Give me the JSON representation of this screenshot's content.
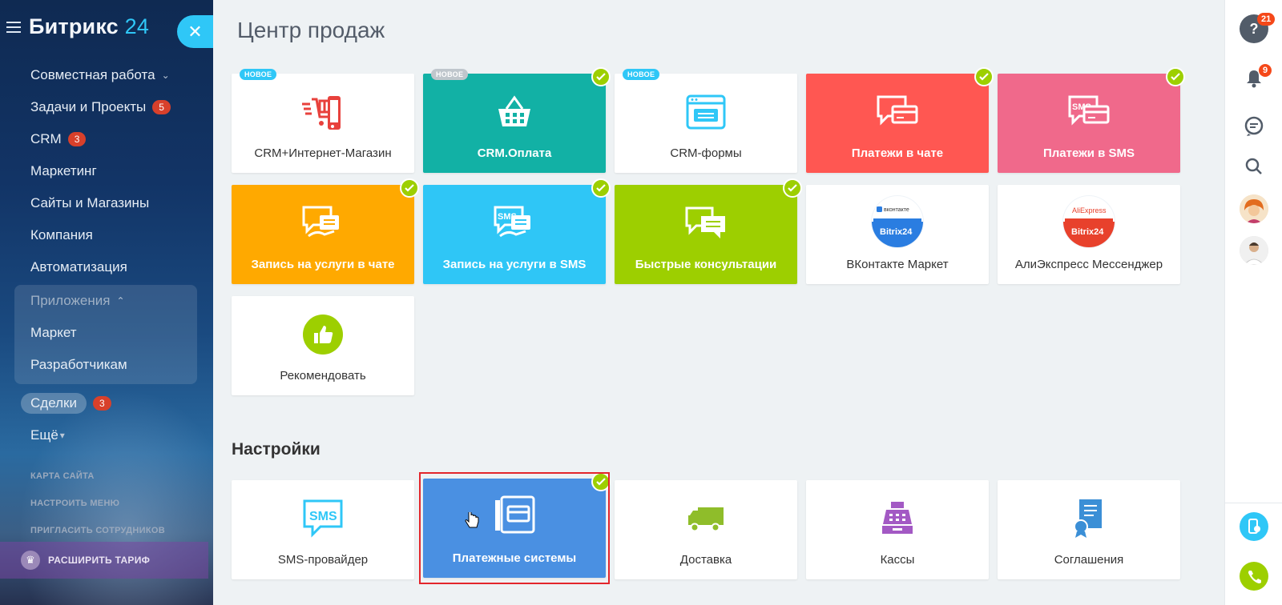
{
  "app": {
    "logo_main": "Битрикс",
    "logo_num": "24",
    "close_symbol": "✕"
  },
  "sidebar": {
    "items": [
      {
        "label": "Совместная работа",
        "chevron": "⌄"
      },
      {
        "label": "Задачи и Проекты",
        "badge": "5"
      },
      {
        "label": "CRM",
        "badge": "3"
      },
      {
        "label": "Маркетинг"
      },
      {
        "label": "Сайты и Магазины"
      },
      {
        "label": "Компания"
      },
      {
        "label": "Автоматизация"
      }
    ],
    "apps_group": {
      "label": "Приложения",
      "chevron": "⌃",
      "items": [
        {
          "label": "Маркет"
        },
        {
          "label": "Разработчикам"
        }
      ]
    },
    "deals": {
      "label": "Сделки",
      "badge": "3"
    },
    "more": {
      "label": "Ещё",
      "chevron": "▾"
    },
    "small_links": [
      "КАРТА САЙТА",
      "НАСТРОИТЬ МЕНЮ",
      "ПРИГЛАСИТЬ СОТРУДНИКОВ"
    ],
    "upgrade_label": "РАСШИРИТЬ ТАРИФ"
  },
  "main": {
    "title": "Центр продаж",
    "settings_title": "Настройки",
    "new_tag": "НОВОЕ",
    "tiles": [
      {
        "label": "CRM+Интернет-Магазин",
        "icon": "cart-icon",
        "tag": "new",
        "bg": "#ffffff"
      },
      {
        "label": "CRM.Оплата",
        "icon": "basket-icon",
        "tag": "new-grey",
        "checked": true,
        "bg": "#12b1a5"
      },
      {
        "label": "CRM-формы",
        "icon": "form-window-icon",
        "tag": "new",
        "bg": "#ffffff"
      },
      {
        "label": "Платежи в чате",
        "icon": "chat-card-icon",
        "checked": true,
        "bg": "#ff5752"
      },
      {
        "label": "Платежи в SMS",
        "icon": "sms-card-icon",
        "checked": true,
        "bg": "#f0698b"
      },
      {
        "label": "Запись на услуги в чате",
        "icon": "chat-booking-icon",
        "checked": true,
        "bg": "#ffa900"
      },
      {
        "label": "Запись на услуги в SMS",
        "icon": "sms-booking-icon",
        "checked": true,
        "bg": "#2fc6f6"
      },
      {
        "label": "Быстрые консультации",
        "icon": "chat-bubbles-icon",
        "checked": true,
        "bg": "#9dcf00"
      },
      {
        "label": "ВКонтакте Маркет",
        "icon": "vk-bitrix-icon",
        "bg": "#ffffff",
        "icon_text_top": "вконтакте",
        "icon_text_bottom": "Bitrix24"
      },
      {
        "label": "АлиЭкспресс Мессенджер",
        "icon": "aliexpress-bitrix-icon",
        "bg": "#ffffff",
        "icon_text_top": "AliExpress",
        "icon_text_bottom": "Bitrix24"
      },
      {
        "label": "Рекомендовать",
        "icon": "thumbs-up-icon",
        "bg": "#ffffff"
      }
    ],
    "settings_tiles": [
      {
        "label": "SMS-провайдер",
        "icon": "sms-bubble-icon",
        "bg": "#ffffff",
        "icon_text": "SMS"
      },
      {
        "label": "Платежные системы",
        "icon": "payment-systems-icon",
        "checked": true,
        "bg": "#4a90e2"
      },
      {
        "label": "Доставка",
        "icon": "truck-icon",
        "bg": "#ffffff"
      },
      {
        "label": "Кассы",
        "icon": "cash-register-icon",
        "bg": "#ffffff"
      },
      {
        "label": "Соглашения",
        "icon": "certificate-icon",
        "bg": "#ffffff"
      }
    ]
  },
  "rightbar": {
    "help_badge": "21",
    "notifications_badge": "9"
  },
  "colors": {
    "accent": "#2fc7f7",
    "check": "#9dcf00",
    "badge": "#d8402b",
    "highlight": "#e3262c"
  }
}
